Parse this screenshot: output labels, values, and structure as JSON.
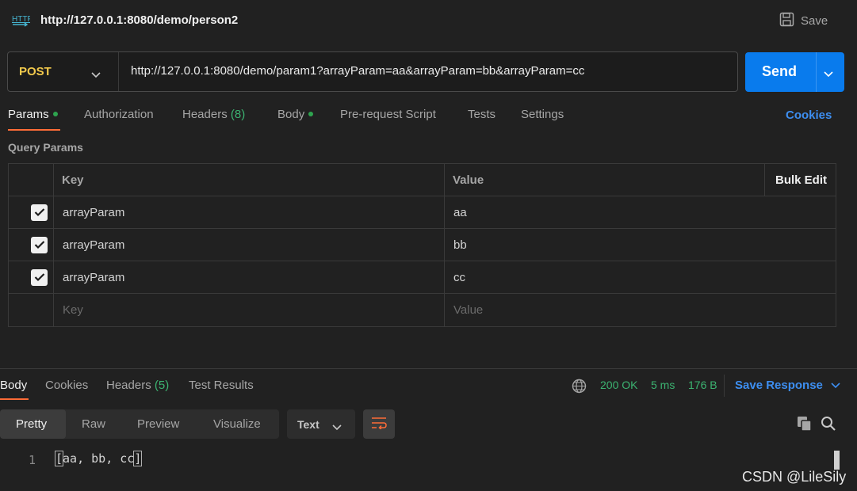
{
  "window": {
    "title": "http://127.0.0.1:8080/demo/person2",
    "save_label": "Save",
    "http_icon": "HTTP"
  },
  "request": {
    "method": "POST",
    "url": "http://127.0.0.1:8080/demo/param1?arrayParam=aa&arrayParam=bb&arrayParam=cc",
    "send_label": "Send"
  },
  "tabs": {
    "params": "Params",
    "authorization": "Authorization",
    "headers": "Headers",
    "headers_count": "(8)",
    "body": "Body",
    "prerequest": "Pre-request Script",
    "tests": "Tests",
    "settings": "Settings",
    "cookies": "Cookies"
  },
  "query_params": {
    "label": "Query Params",
    "col_key": "Key",
    "col_value": "Value",
    "bulk_edit": "Bulk Edit",
    "rows": [
      {
        "key": "arrayParam",
        "value": "aa",
        "checked": true
      },
      {
        "key": "arrayParam",
        "value": "bb",
        "checked": true
      },
      {
        "key": "arrayParam",
        "value": "cc",
        "checked": true
      }
    ],
    "placeholder_key": "Key",
    "placeholder_value": "Value"
  },
  "response": {
    "tabs": {
      "body": "Body",
      "cookies": "Cookies",
      "headers": "Headers",
      "headers_count": "(5)",
      "test_results": "Test Results"
    },
    "status": "200 OK",
    "time": "5 ms",
    "size": "176 B",
    "save_response": "Save Response",
    "views": {
      "pretty": "Pretty",
      "raw": "Raw",
      "preview": "Preview",
      "visualize": "Visualize"
    },
    "format": "Text",
    "line_number": "1",
    "body_open": "[",
    "body_inner": "aa, bb, cc",
    "body_close": "]"
  },
  "watermark": "CSDN @LileSily"
}
